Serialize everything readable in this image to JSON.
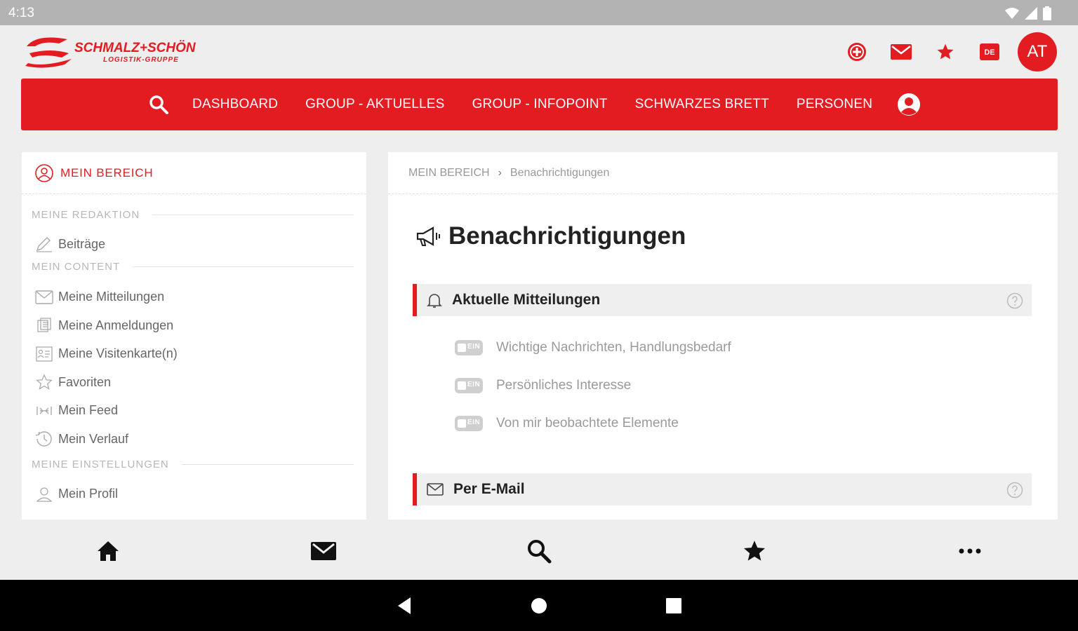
{
  "status_bar": {
    "time": "4:13"
  },
  "logo": {
    "line1": "SCHMALZ+SCHÖN",
    "line2": "LOGISTIK-GRUPPE"
  },
  "header": {
    "avatar_initials": "AT"
  },
  "nav": {
    "items": [
      {
        "label": "DASHBOARD"
      },
      {
        "label": "GROUP - AKTUELLES"
      },
      {
        "label": "GROUP - INFOPOINT"
      },
      {
        "label": "SCHWARZES BRETT"
      },
      {
        "label": "PERSONEN"
      }
    ]
  },
  "sidebar": {
    "title": "MEIN BEREICH",
    "sections": [
      {
        "label": "MEINE REDAKTION"
      },
      {
        "label": "MEIN CONTENT"
      },
      {
        "label": "MEINE EINSTELLUNGEN"
      }
    ],
    "items": [
      {
        "label": "Beiträge",
        "icon": "pen-icon"
      },
      {
        "label": "Meine Mitteilungen",
        "icon": "envelope-icon"
      },
      {
        "label": "Meine Anmeldungen",
        "icon": "registration-icon"
      },
      {
        "label": "Meine Visitenkarte(n)",
        "icon": "business-card-icon"
      },
      {
        "label": "Favoriten",
        "icon": "star-outline-icon"
      },
      {
        "label": "Mein Feed",
        "icon": "feed-icon"
      },
      {
        "label": "Mein Verlauf",
        "icon": "history-icon"
      },
      {
        "label": "Mein Profil",
        "icon": "user-outline-icon"
      }
    ]
  },
  "main": {
    "breadcrumb": {
      "root": "MEIN BEREICH",
      "current": "Benachrichtigungen"
    },
    "title": "Benachrichtigungen",
    "sections": [
      {
        "title": "Aktuelle Mitteilungen",
        "options": [
          {
            "label": "Wichtige Nachrichten, Handlungsbedarf",
            "toggle": "EIN"
          },
          {
            "label": "Persönliches Interesse",
            "toggle": "EIN"
          },
          {
            "label": "Von mir beobachtete Elemente",
            "toggle": "EIN"
          }
        ]
      },
      {
        "title": "Per E-Mail"
      }
    ]
  },
  "colors": {
    "brand_red": "#e21c21",
    "background": "#eeeeee"
  }
}
